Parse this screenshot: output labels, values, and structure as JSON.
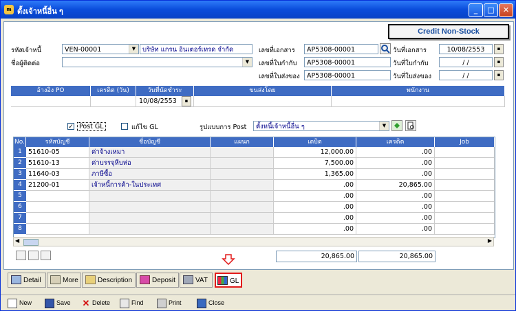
{
  "window": {
    "title": "ตั้งเจ้าหนี้อื่น ๆ",
    "app_icon": "app-icon",
    "controls": {
      "minimize": "_",
      "maximize": "□",
      "close": "✕"
    }
  },
  "credit_badge": "Credit  Non-Stock",
  "form": {
    "vendor_code_label": "รหัสเจ้าหนี้",
    "vendor_code": "VEN-00001",
    "vendor_name": "บริษัท แกรน อินเตอร์เทรด จำกัด",
    "contact_label": "ชื่อผู้ติดต่อ",
    "contact": "",
    "doc_no_label": "เลขที่เอกสาร",
    "doc_no": "AP5308-00001",
    "doc_date_label": "วันที่เอกสาร",
    "doc_date": "10/08/2553",
    "invoice_no_label": "เลขที่ใบกำกับ",
    "invoice_no": "AP5308-00001",
    "invoice_date_label": "วันที่ใบกำกับ",
    "invoice_date": " / / ",
    "delivery_no_label": "เลขที่ใบส่งของ",
    "delivery_no": "AP5308-00001",
    "delivery_date_label": "วันที่ใบส่งของ",
    "delivery_date": " / / "
  },
  "terms_header": {
    "ref_po": "อ้างอิง PO",
    "credit_days": "เครดิต (วัน)",
    "due_date": "วันที่นัดชำระ",
    "ship_by": "ขนส่งโดย",
    "employee": "พนักงาน"
  },
  "terms_values": {
    "ref_po": "",
    "credit_days": "",
    "due_date": "10/08/2553",
    "ship_by": "",
    "employee": ""
  },
  "gl_options": {
    "post_gl_label": "Post GL",
    "post_gl_checked": true,
    "edit_gl_label": "แก้ไข GL",
    "edit_gl_checked": false,
    "post_format_label": "รูปแบบการ Post",
    "post_format_value": "ตั้งหนี้เจ้าหนี้อื่น ๆ"
  },
  "grid": {
    "columns": [
      "No.",
      "รหัสบัญชี",
      "ชื่อบัญชี",
      "แผนก",
      "เดบิต",
      "เครดิต",
      "Job"
    ],
    "rows": [
      {
        "no": "1",
        "code": "51610-05",
        "name": "ค่าจ้างเหมา",
        "dept": "",
        "debit": "12,000.00",
        "credit": ".00",
        "job": ""
      },
      {
        "no": "2",
        "code": "51610-13",
        "name": "ค่าบรรจุหีบห่อ",
        "dept": "",
        "debit": "7,500.00",
        "credit": ".00",
        "job": ""
      },
      {
        "no": "3",
        "code": "11640-03",
        "name": "ภาษีซื้อ",
        "dept": "",
        "debit": "1,365.00",
        "credit": ".00",
        "job": ""
      },
      {
        "no": "4",
        "code": "21200-01",
        "name": "เจ้าหนี้การค้า-ในประเทศ",
        "dept": "",
        "debit": ".00",
        "credit": "20,865.00",
        "job": ""
      },
      {
        "no": "5",
        "code": "",
        "name": "",
        "dept": "",
        "debit": ".00",
        "credit": ".00",
        "job": ""
      },
      {
        "no": "6",
        "code": "",
        "name": "",
        "dept": "",
        "debit": ".00",
        "credit": ".00",
        "job": ""
      },
      {
        "no": "7",
        "code": "",
        "name": "",
        "dept": "",
        "debit": ".00",
        "credit": ".00",
        "job": ""
      },
      {
        "no": "8",
        "code": "",
        "name": "",
        "dept": "",
        "debit": ".00",
        "credit": ".00",
        "job": ""
      }
    ]
  },
  "totals": {
    "debit": "20,865.00",
    "credit": "20,865.00"
  },
  "tabs": [
    {
      "label": "Detail",
      "icon": "detail-icon"
    },
    {
      "label": "More",
      "icon": "more-icon"
    },
    {
      "label": "Description",
      "icon": "description-icon"
    },
    {
      "label": "Deposit",
      "icon": "deposit-icon"
    },
    {
      "label": "VAT",
      "icon": "vat-icon"
    },
    {
      "label": "GL",
      "icon": "gl-icon",
      "active": true
    }
  ],
  "toolbar": {
    "new": "New",
    "save": "Save",
    "delete": "Delete",
    "find": "Find",
    "print": "Print",
    "close": "Close"
  },
  "colors": {
    "header_blue": "#3F6CC3",
    "title_blue": "#0A4CDB",
    "highlight_red": "#E21B1B",
    "text_blue": "#00008B"
  }
}
